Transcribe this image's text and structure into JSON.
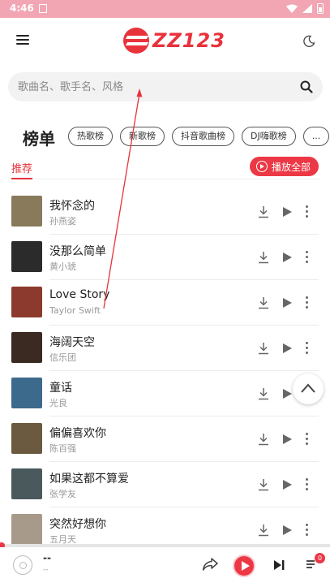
{
  "status_bar": {
    "time": "4:46"
  },
  "header": {
    "logo_text": "ZZ123"
  },
  "search": {
    "placeholder": "歌曲名、歌手名、风格"
  },
  "charts": {
    "title": "榜单",
    "tags": [
      "热歌榜",
      "新歌榜",
      "抖音歌曲榜",
      "DJ嗨歌榜",
      "..."
    ]
  },
  "tabs": {
    "active": "推荐",
    "play_all_label": "播放全部"
  },
  "songs": [
    {
      "title": "我怀念的",
      "artist": "孙燕姿",
      "cover_color": "#8a7a5c"
    },
    {
      "title": "没那么简单",
      "artist": "黄小琥",
      "cover_color": "#2b2b2b"
    },
    {
      "title": "Love Story",
      "artist": "Taylor Swift",
      "cover_color": "#8c3a2e"
    },
    {
      "title": "海阔天空",
      "artist": "信乐团",
      "cover_color": "#3a2a22"
    },
    {
      "title": "童话",
      "artist": "光良",
      "cover_color": "#3c6a8c"
    },
    {
      "title": "偏偏喜欢你",
      "artist": "陈百强",
      "cover_color": "#6b5a40"
    },
    {
      "title": "如果这都不算爱",
      "artist": "张学友",
      "cover_color": "#4a5a5c"
    },
    {
      "title": "突然好想你",
      "artist": "五月天",
      "cover_color": "#a89a8a"
    }
  ],
  "player": {
    "title": "--",
    "artist": "--",
    "queue_count": "0",
    "progress": 0
  },
  "colors": {
    "accent": "#ec3845",
    "status_bar": "#f2a6b4"
  }
}
